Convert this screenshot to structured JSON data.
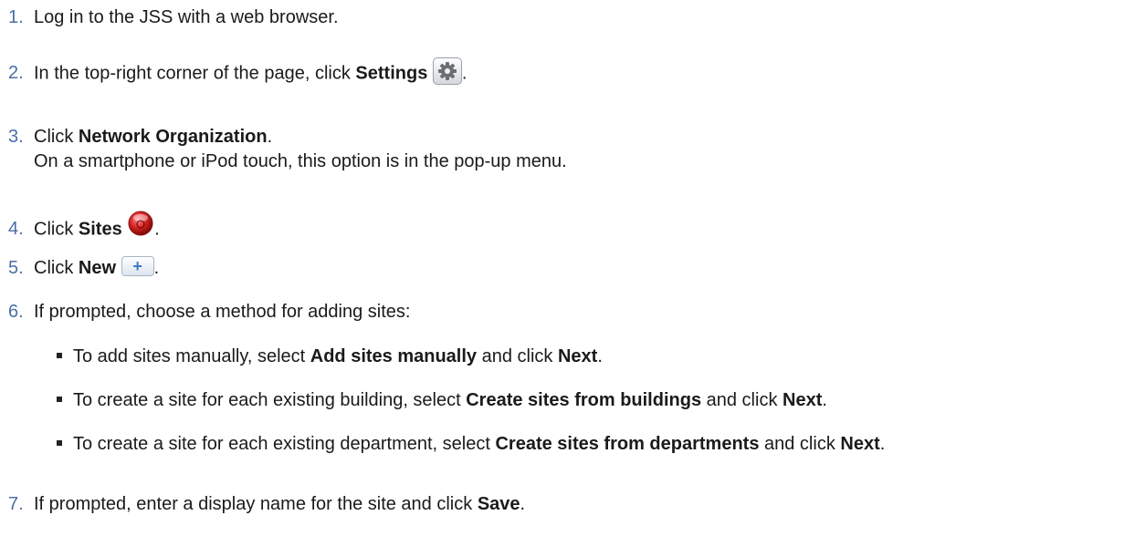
{
  "steps": [
    {
      "num": "1.",
      "text": "Log in to the JSS with a web browser."
    },
    {
      "num": "2.",
      "pre": "In the top-right corner of the page, click ",
      "bold": "Settings",
      "post": "."
    },
    {
      "num": "3.",
      "pre": "Click ",
      "bold": "Network Organization",
      "post": ".",
      "sub": "On a smartphone or iPod touch, this option is in the pop-up menu."
    },
    {
      "num": "4.",
      "pre": "Click ",
      "bold": "Sites",
      "post": "."
    },
    {
      "num": "5.",
      "pre": "Click ",
      "bold": "New",
      "post": "."
    },
    {
      "num": "6.",
      "text": "If prompted, choose a method for adding sites:"
    },
    {
      "num": "7.",
      "pre": "If prompted, enter a display name for the site and click ",
      "bold": "Save",
      "post": "."
    }
  ],
  "bullets": [
    {
      "pre": "To add sites manually, select ",
      "bold1": "Add sites manually",
      "mid": " and click ",
      "bold2": "Next",
      "post": "."
    },
    {
      "pre": "To create a site for each existing building, select ",
      "bold1": "Create sites from buildings",
      "mid": " and click ",
      "bold2": "Next",
      "post": "."
    },
    {
      "pre": "To create a site for each existing department, select ",
      "bold1": "Create sites from departments",
      "mid": " and click ",
      "bold2": "Next",
      "post": "."
    }
  ],
  "icons": {
    "plus_glyph": "+"
  },
  "colors": {
    "step_number": "#4a6fa5",
    "plus_icon": "#3a78c8",
    "sites_icon": "#d42020"
  }
}
